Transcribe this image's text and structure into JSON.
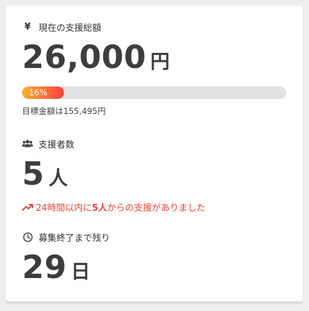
{
  "amount": {
    "icon": "yen-icon",
    "currency_symbol": "¥",
    "label": "現在の支援総額",
    "value": "26,000",
    "unit": "円",
    "progress_percent": 16,
    "progress_label": "16%",
    "target_text": "目標金額は155,495円",
    "colors": {
      "progress_start": "#ffb033",
      "progress_end": "#ff3e3e",
      "track": "#e2e2e2"
    }
  },
  "supporters": {
    "icon": "users-icon",
    "label": "支援者数",
    "value": "5",
    "unit": "人",
    "trend_icon": "trending-up-icon",
    "trend_prefix": "24時間以内に",
    "trend_count": "5人",
    "trend_suffix": "からの支援がありました",
    "trend_color": "#e8473a"
  },
  "remaining": {
    "icon": "clock-icon",
    "label": "募集終了まで残り",
    "value": "29",
    "unit": "日"
  }
}
